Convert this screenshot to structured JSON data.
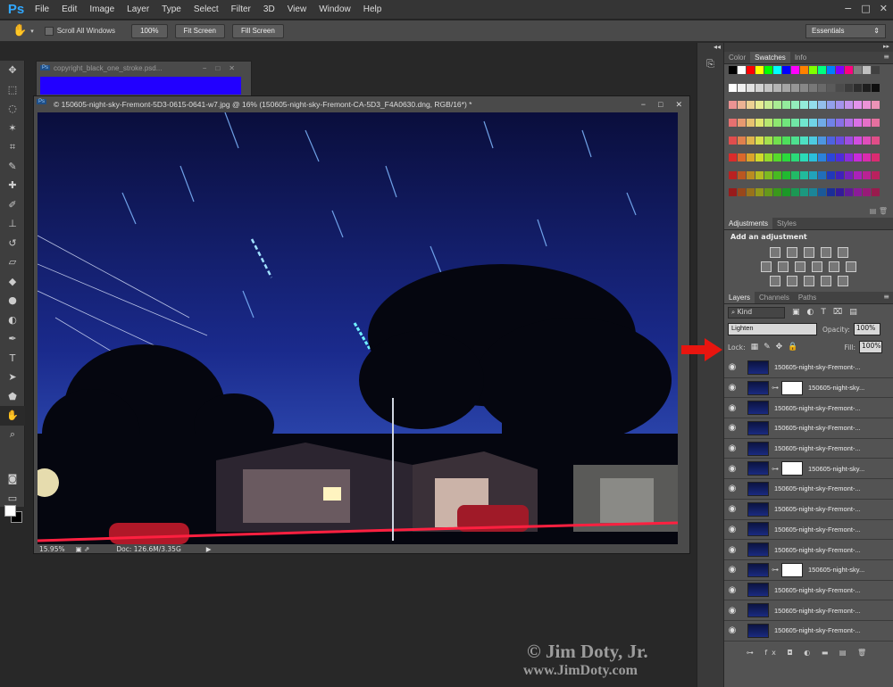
{
  "app": {
    "logo": "Ps"
  },
  "menu": [
    "File",
    "Edit",
    "Image",
    "Layer",
    "Type",
    "Select",
    "Filter",
    "3D",
    "View",
    "Window",
    "Help"
  ],
  "window_controls": {
    "minimize": "−",
    "maximize": "□",
    "close": "✕"
  },
  "options": {
    "scroll_all": "Scroll All Windows",
    "btn_100": "100%",
    "btn_fit": "Fit Screen",
    "btn_fill": "Fill Screen",
    "workspace": "Essentials"
  },
  "back_doc": {
    "title": "copyright_black_one_stroke.psd..."
  },
  "doc": {
    "title": "© 150605-night-sky-Fremont-5D3-0615-0641-w7.jpg @ 16% (150605-night-sky-Fremont-CA-5D3_F4A0630.dng, RGB/16*) *",
    "zoom": "15.95%",
    "doc_size": "Doc: 126.6M/3.35G"
  },
  "swatch_panel": {
    "tabs": [
      "Color",
      "Swatches",
      "Info"
    ],
    "colors": [
      "#000000",
      "#ffffff",
      "#ff0000",
      "#ffff00",
      "#00ff00",
      "#00ffff",
      "#0000ff",
      "#ff00ff",
      "#ff8000",
      "#80ff00",
      "#00ff80",
      "#0080ff",
      "#8000ff",
      "#ff0080",
      "#808080",
      "#c0c0c0",
      "#404040"
    ]
  },
  "adjustments": {
    "tabs": [
      "Adjustments",
      "Styles"
    ],
    "heading": "Add an adjustment"
  },
  "layers_panel": {
    "tabs": [
      "Layers",
      "Channels",
      "Paths"
    ],
    "filter": "Kind",
    "blend_mode": "Lighten",
    "opacity_label": "Opacity:",
    "opacity": "100%",
    "lock_label": "Lock:",
    "fill_label": "Fill:",
    "fill": "100%",
    "layers": [
      {
        "name": "150605-night-sky-Fremont-...",
        "mask": false
      },
      {
        "name": "150605-night-sky...",
        "mask": true
      },
      {
        "name": "150605-night-sky-Fremont-...",
        "mask": false
      },
      {
        "name": "150605-night-sky-Fremont-...",
        "mask": false
      },
      {
        "name": "150605-night-sky-Fremont-...",
        "mask": false
      },
      {
        "name": "150605-night-sky...",
        "mask": true
      },
      {
        "name": "150605-night-sky-Fremont-...",
        "mask": false
      },
      {
        "name": "150605-night-sky-Fremont-...",
        "mask": false
      },
      {
        "name": "150605-night-sky-Fremont-...",
        "mask": false
      },
      {
        "name": "150605-night-sky-Fremont-...",
        "mask": false
      },
      {
        "name": "150605-night-sky...",
        "mask": true
      },
      {
        "name": "150605-night-sky-Fremont-...",
        "mask": false
      },
      {
        "name": "150605-night-sky-Fremont-...",
        "mask": false
      },
      {
        "name": "150605-night-sky-Fremont-...",
        "mask": false
      }
    ]
  },
  "watermark": {
    "line1": "© Jim Doty, Jr.",
    "line2": "www.JimDoty.com"
  },
  "colors": {
    "accent_blue": "#31a8ff",
    "arrow_red": "#e8150f",
    "sky_top": "#0a0e3c",
    "sky_bottom": "#3250b8"
  }
}
